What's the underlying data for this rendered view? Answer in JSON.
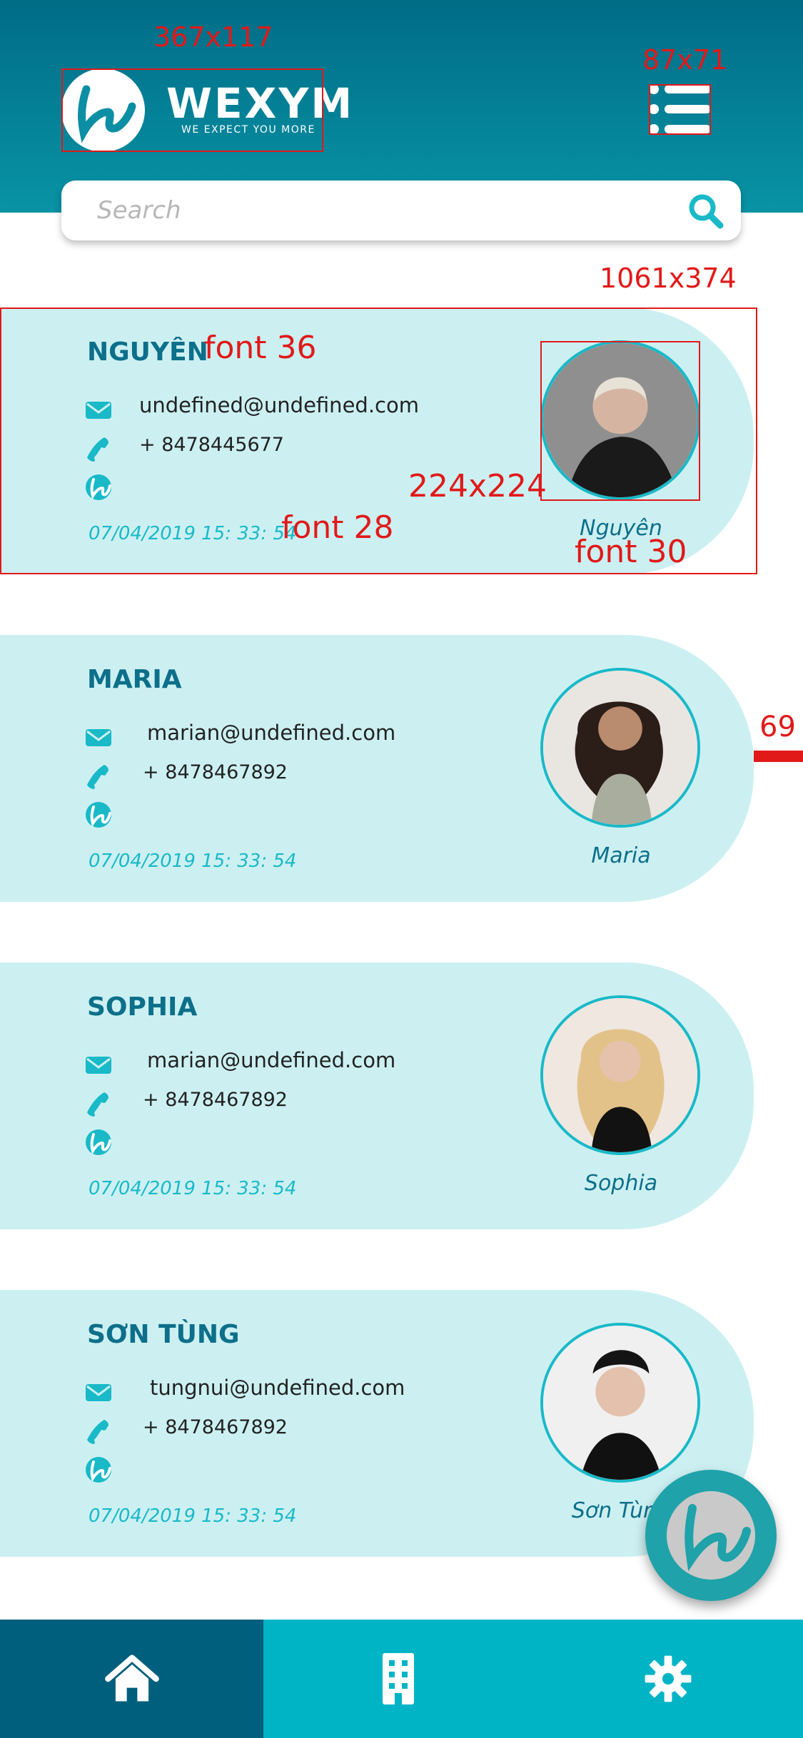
{
  "app": {
    "logo_text": "WEXYM",
    "logo_tagline": "WE EXPECT YOU MORE"
  },
  "search": {
    "placeholder": "Search"
  },
  "contacts": [
    {
      "name": "NGUYÊN",
      "email": "undefined@undefined.com",
      "phone": "+ 8478445677",
      "date": "07/04/2019 15: 33: 54",
      "caption": "Nguyên",
      "avatar_bg": "#8f8f8f"
    },
    {
      "name": "MARIA",
      "email": "marian@undefined.com",
      "phone": "+ 8478467892",
      "date": "07/04/2019 15: 33: 54",
      "caption": "Maria",
      "avatar_bg": "#e9e6e2"
    },
    {
      "name": "SOPHIA",
      "email": "marian@undefined.com",
      "phone": "+ 8478467892",
      "date": "07/04/2019 15: 33: 54",
      "caption": "Sophia",
      "avatar_bg": "#efe7e0"
    },
    {
      "name": "SƠN TÙNG",
      "email": "tungnui@undefined.com",
      "phone": "+ 8478467892",
      "date": "07/04/2019 15: 33: 54",
      "caption": "Sơn Tùng",
      "avatar_bg": "#f0f0f0"
    }
  ],
  "annotations": [
    {
      "text": "367x117"
    },
    {
      "text": "87x71"
    },
    {
      "text": "1061x374"
    },
    {
      "text": "font 36"
    },
    {
      "text": "224x224"
    },
    {
      "text": "font 28"
    },
    {
      "text": "font 30"
    },
    {
      "text": "69"
    }
  ],
  "tabs": [
    {
      "icon": "home-icon",
      "active": true
    },
    {
      "icon": "building-icon",
      "active": false
    },
    {
      "icon": "gear-icon",
      "active": false
    }
  ],
  "colors": {
    "header_top": "#006c86",
    "header_bottom": "#0893a5",
    "card_bg": "#ccf0f2",
    "accent": "#19b9c8",
    "name": "#0d6f8a",
    "tabbar": "#00b4c6",
    "tab_active": "#005f7c",
    "annotation": "#e11919"
  }
}
